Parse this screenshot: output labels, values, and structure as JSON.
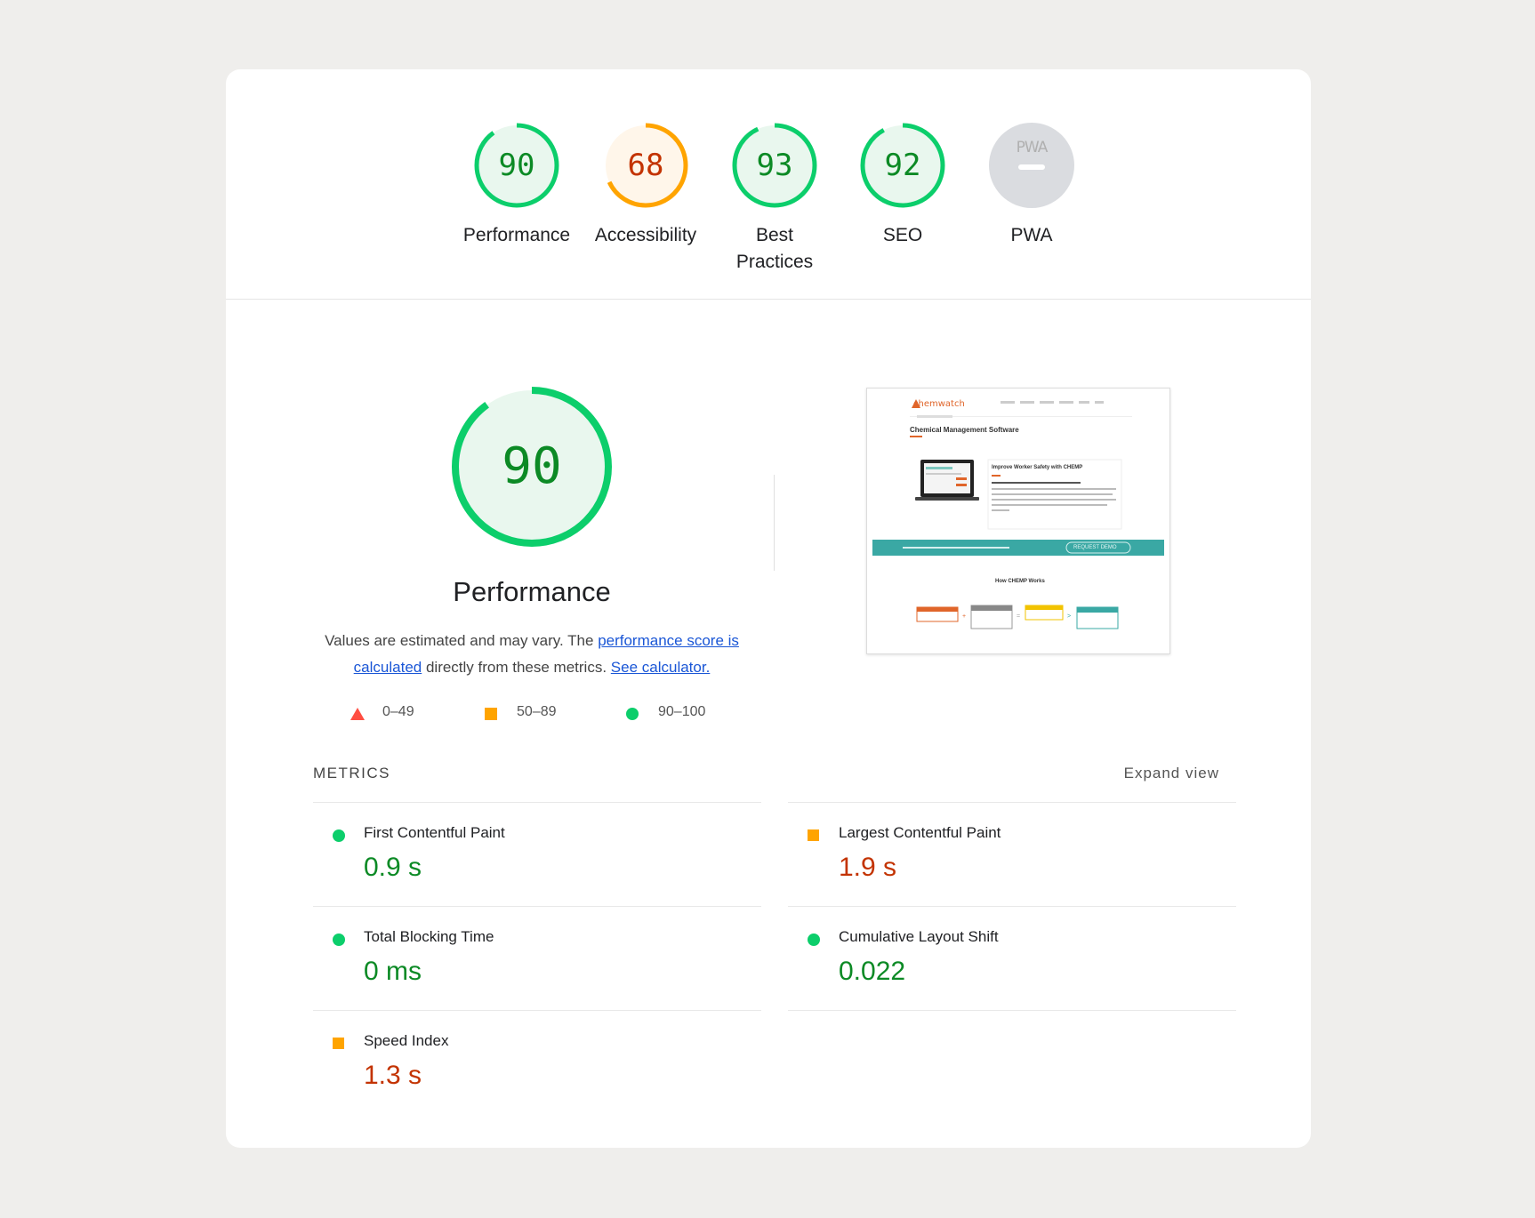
{
  "gauges": [
    {
      "score": "90",
      "label": "Performance",
      "fraction": 0.9,
      "color": "#0cce6b",
      "fill": "#e9f7ee"
    },
    {
      "score": "68",
      "label": "Accessibility",
      "fraction": 0.68,
      "color": "#ffa400",
      "fill": "#fff6ea"
    },
    {
      "score": "93",
      "label": "Best Practices",
      "fraction": 0.93,
      "color": "#0cce6b",
      "fill": "#e9f7ee"
    },
    {
      "score": "92",
      "label": "SEO",
      "fraction": 0.92,
      "color": "#0cce6b",
      "fill": "#e9f7ee"
    },
    {
      "score": "PWA",
      "label": "PWA",
      "fraction": 0,
      "color": "#dadce0",
      "fill": "#dadce0"
    }
  ],
  "performance": {
    "score": "90",
    "fraction": 0.9,
    "title": "Performance",
    "desc_prefix": "Values are estimated and may vary. The ",
    "desc_link1": "performance score is calculated",
    "desc_mid": " directly from these metrics. ",
    "desc_link2": "See calculator.",
    "legend": [
      {
        "range": "0–49",
        "shape": "triangle",
        "color": "#ff4e42"
      },
      {
        "range": "50–89",
        "shape": "square",
        "color": "#ffa400"
      },
      {
        "range": "90–100",
        "shape": "circle",
        "color": "#0cce6b"
      }
    ]
  },
  "thumbnail": {
    "logo": "chemwatch",
    "title": "Chemical Management Software",
    "heading": "Improve Worker Safety with CHEMP",
    "cta": "REQUEST DEMO",
    "sub": "How CHEMP Works"
  },
  "metrics": {
    "header": "METRICS",
    "expand_label": "Expand view",
    "left": [
      {
        "name": "First Contentful Paint",
        "value": "0.9 s",
        "status": "good"
      },
      {
        "name": "Total Blocking Time",
        "value": "0 ms",
        "status": "good"
      },
      {
        "name": "Speed Index",
        "value": "1.3 s",
        "status": "average"
      }
    ],
    "right": [
      {
        "name": "Largest Contentful Paint",
        "value": "1.9 s",
        "status": "average"
      },
      {
        "name": "Cumulative Layout Shift",
        "value": "0.022",
        "status": "good"
      }
    ]
  },
  "colors": {
    "good": "#0cce6b",
    "average": "#ffa400",
    "poor": "#ff4e42",
    "good_text": "#0c8a25",
    "average_text": "#c33300"
  }
}
